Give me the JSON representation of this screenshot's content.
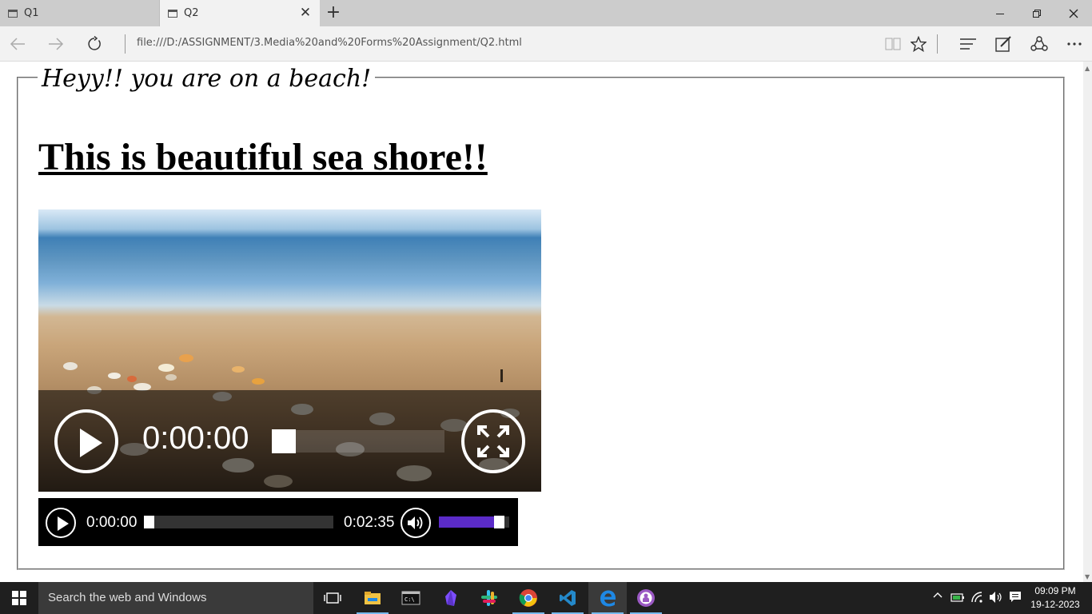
{
  "browser": {
    "tabs": [
      {
        "label": "Q1",
        "active": false
      },
      {
        "label": "Q2",
        "active": true
      }
    ],
    "url": "file:///D:/ASSIGNMENT/3.Media%20and%20Forms%20Assignment/Q2.html"
  },
  "page": {
    "legend": "Heyy!! you are on a beach!",
    "heading": "This is beautiful sea shore!!",
    "video": {
      "current_time": "0:00:00",
      "progress": 0
    },
    "audio": {
      "current_time": "0:00:00",
      "duration": "0:02:35",
      "progress": 0,
      "volume": 0.85,
      "volume_color": "#5b2bc8"
    }
  },
  "taskbar": {
    "search_placeholder": "Search the web and Windows",
    "apps": [
      "task-view-icon",
      "file-explorer-icon",
      "terminal-icon",
      "obsidian-icon",
      "slack-icon",
      "chrome-icon",
      "vscode-icon",
      "edge-icon",
      "github-desktop-icon"
    ],
    "time": "09:09 PM",
    "date": "19-12-2023"
  }
}
